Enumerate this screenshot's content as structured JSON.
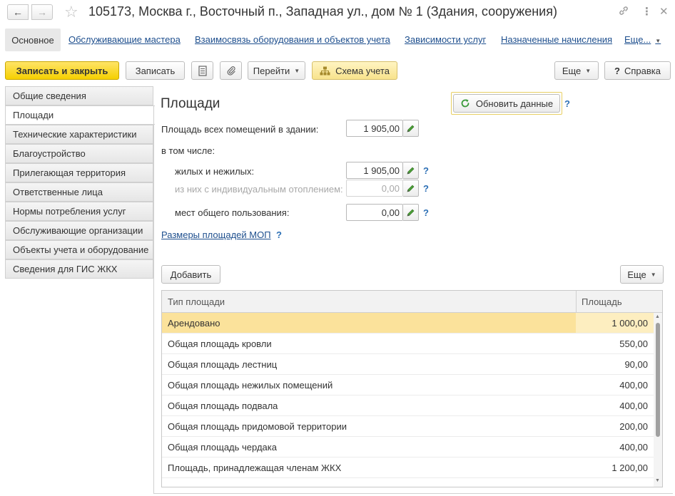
{
  "window": {
    "title": "105173, Москва г., Восточный п., Западная ул., дом № 1 (Здания, сооружения)"
  },
  "icons": {
    "back": "arrow-left-icon",
    "forward": "arrow-right-icon",
    "favorite": "star-icon",
    "link": "link-icon",
    "menu": "more-vertical-icon",
    "close": "close-icon"
  },
  "topnav": {
    "main": "Основное",
    "links": [
      "Обслуживающие мастера",
      "Взаимосвязь оборудования и объектов учета",
      "Зависимости услуг",
      "Назначенные начисления"
    ],
    "more": "Еще..."
  },
  "toolbar": {
    "save_close": "Записать и закрыть",
    "save": "Записать",
    "goto": "Перейти",
    "schema": "Схема учета",
    "more": "Еще",
    "help": "Справка"
  },
  "sidebar": {
    "items": [
      "Общие сведения",
      "Площади",
      "Технические характеристики",
      "Благоустройство",
      "Прилегающая территория",
      "Ответственные лица",
      "Нормы потребления услуг",
      "Обслуживающие организации",
      "Объекты учета и оборудование",
      "Сведения для ГИС ЖКХ"
    ],
    "active_index": 1
  },
  "content": {
    "heading": "Площади",
    "refresh": "Обновить данные",
    "help_mark": "?",
    "total_label": "Площадь всех помещений в здании:",
    "total_value": "1 905,00",
    "including": "в том числе:",
    "residential_label": "жилых и нежилых:",
    "residential_value": "1 905,00",
    "individual_label": "из них с индивидуальным отоплением:",
    "individual_value": "0,00",
    "common_label": "мест общего пользования:",
    "common_value": "0,00",
    "mop_link": "Размеры площадей МОП"
  },
  "table": {
    "add": "Добавить",
    "more": "Еще",
    "columns": [
      "Тип площади",
      "Площадь"
    ],
    "rows": [
      {
        "type": "Арендовано",
        "area": "1 000,00"
      },
      {
        "type": "Общая площадь кровли",
        "area": "550,00"
      },
      {
        "type": "Общая площадь лестниц",
        "area": "90,00"
      },
      {
        "type": "Общая площадь нежилых помещений",
        "area": "400,00"
      },
      {
        "type": "Общая площадь подвала",
        "area": "400,00"
      },
      {
        "type": "Общая площадь придомовой территории",
        "area": "200,00"
      },
      {
        "type": "Общая площадь чердака",
        "area": "400,00"
      },
      {
        "type": "Площадь, принадлежащая членам ЖКХ",
        "area": "1 200,00"
      }
    ],
    "selected_index": 0
  }
}
